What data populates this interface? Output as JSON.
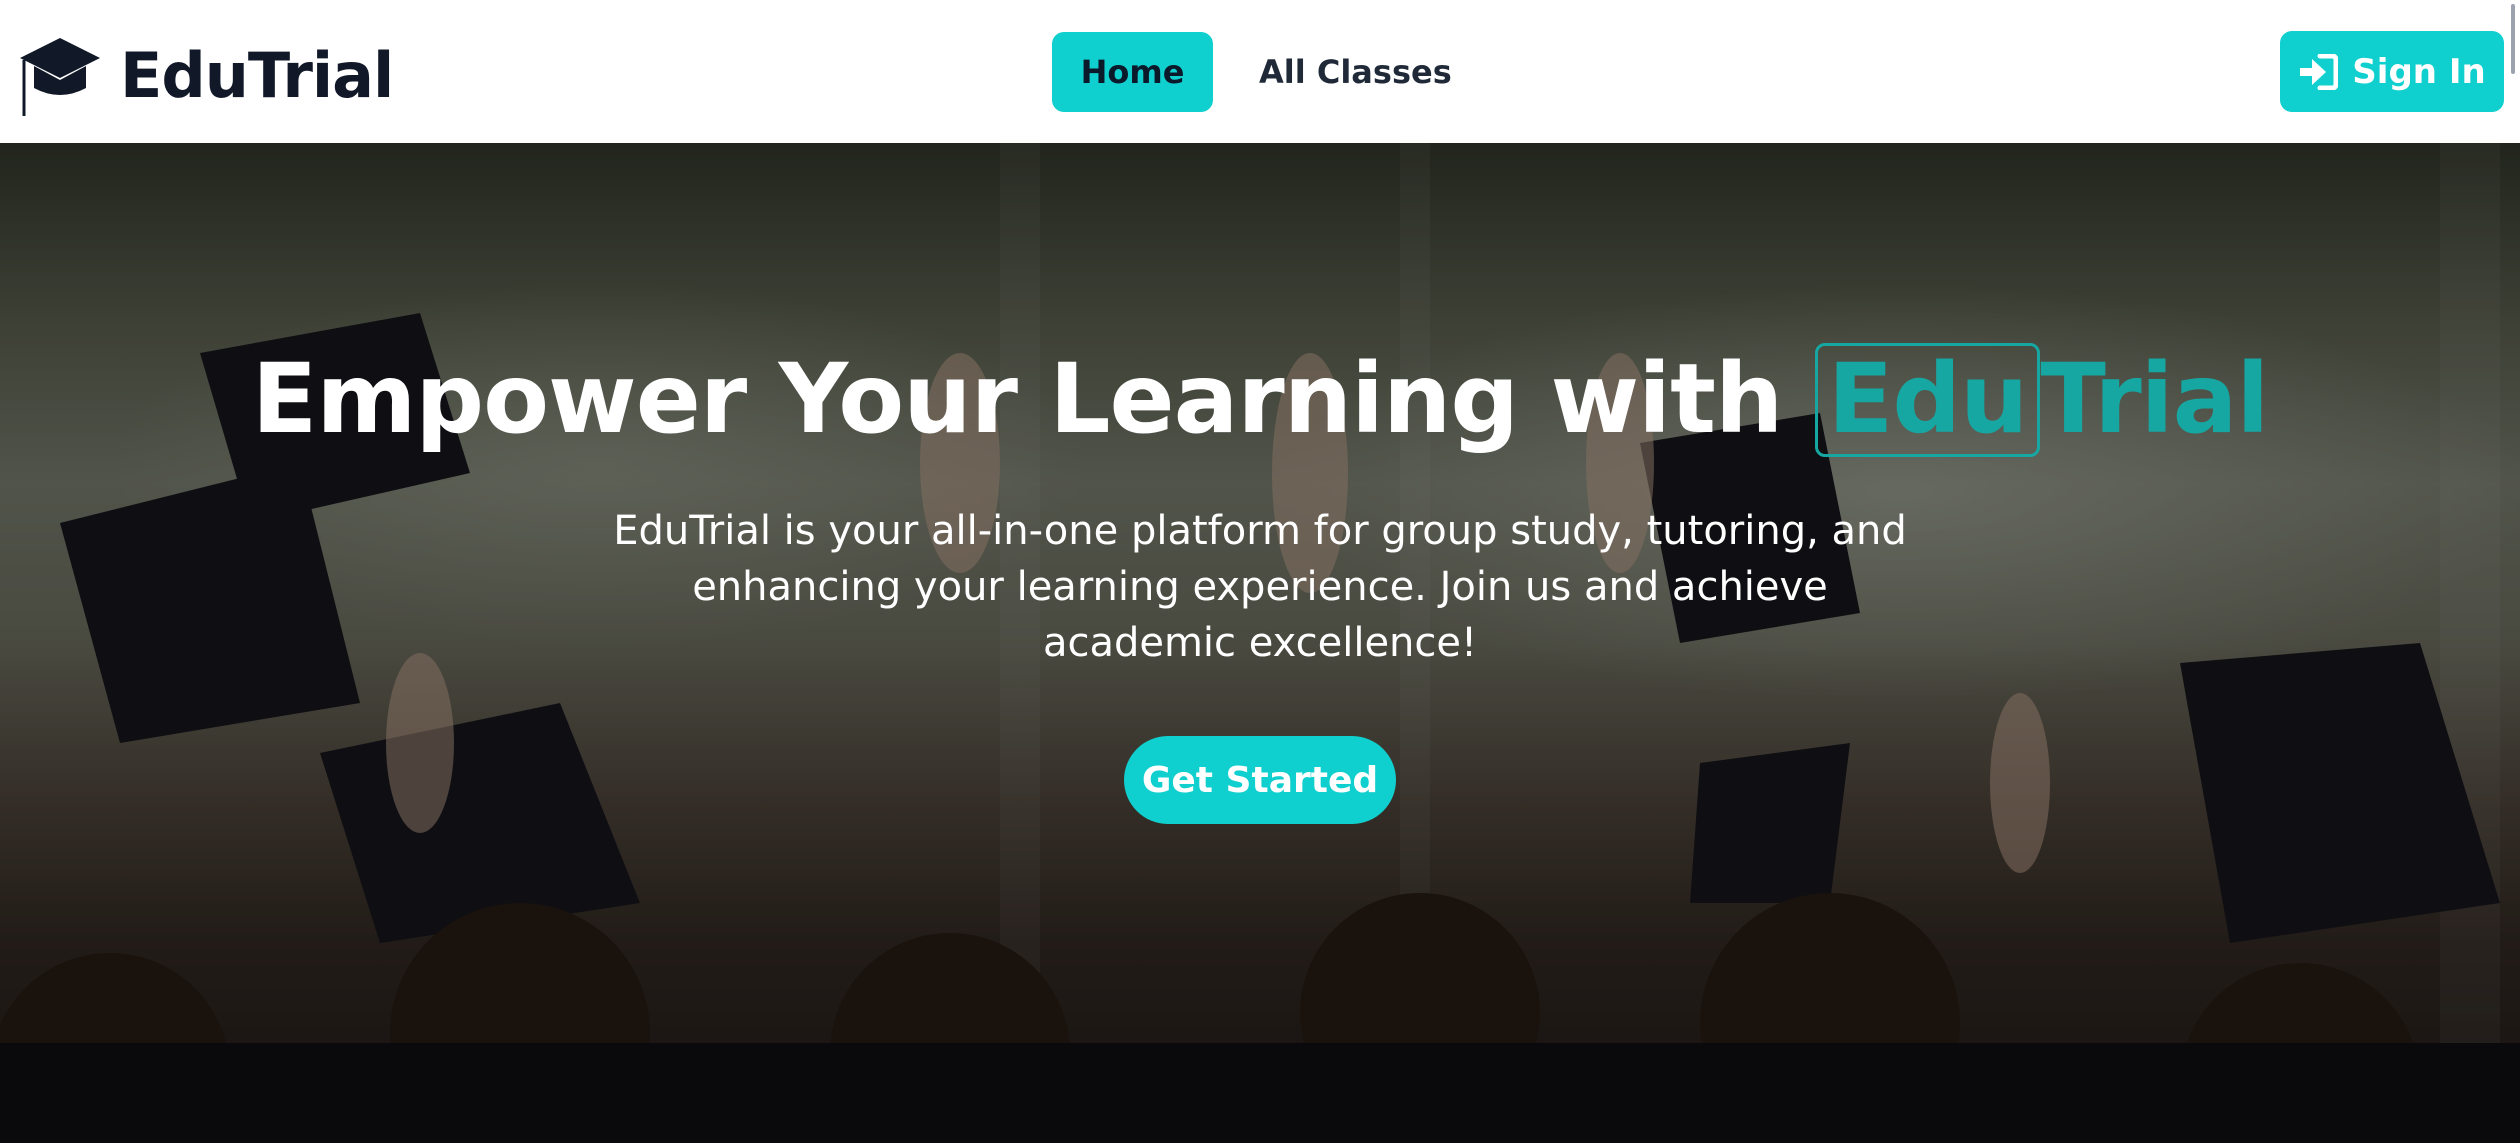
{
  "brand": {
    "name": "EduTrial",
    "icon": "graduation-cap-icon"
  },
  "nav": {
    "items": [
      {
        "label": "Home",
        "active": true
      },
      {
        "label": "All Classes",
        "active": false
      }
    ],
    "signin": {
      "label": "Sign In",
      "icon": "sign-in-icon"
    }
  },
  "hero": {
    "title_prefix": "Empower Your Learning with",
    "title_brand_1": "Edu",
    "title_brand_2": "Trial",
    "subtitle": "EduTrial is your all-in-one platform for group study, tutoring, and enhancing your learning experience. Join us and achieve academic excellence!",
    "cta_label": "Get Started",
    "background": "graduation-cap-toss-photo"
  },
  "colors": {
    "accent": "#10cfcf",
    "brand_teal": "#17a7a2",
    "text_dark": "#111827"
  }
}
